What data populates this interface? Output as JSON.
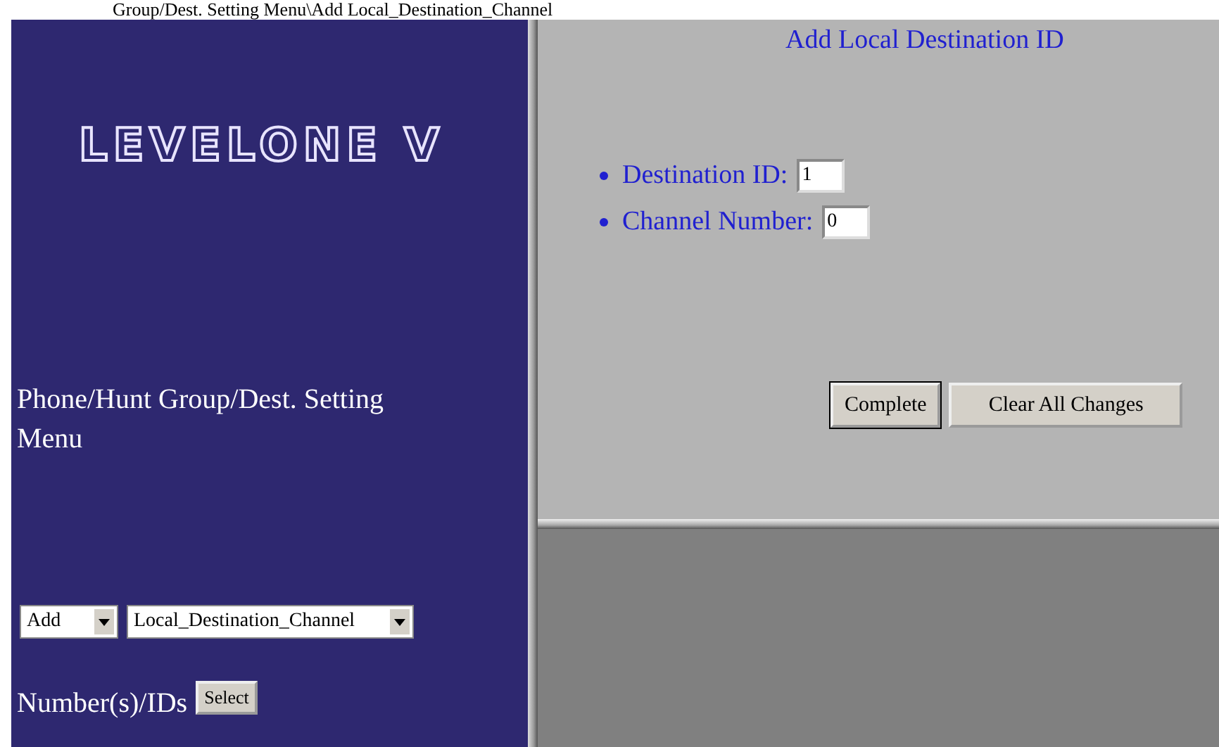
{
  "caption": "Group/Dest. Setting Menu\\Add Local_Destination_Channel",
  "sidebar": {
    "logo": "LEVELONE V",
    "menu_title": "Phone/Hunt Group/Dest. Setting Menu",
    "action_select": {
      "value": "Add"
    },
    "type_select": {
      "value": "Local_Destination_Channel"
    },
    "numbers_label": "Number(s)/IDs",
    "select_button": "Select"
  },
  "form": {
    "title": "Add Local Destination ID",
    "fields": [
      {
        "label": "Destination ID:",
        "value": "1"
      },
      {
        "label": "Channel Number:",
        "value": "0"
      }
    ],
    "buttons": [
      "Complete",
      "Clear All Changes"
    ]
  }
}
